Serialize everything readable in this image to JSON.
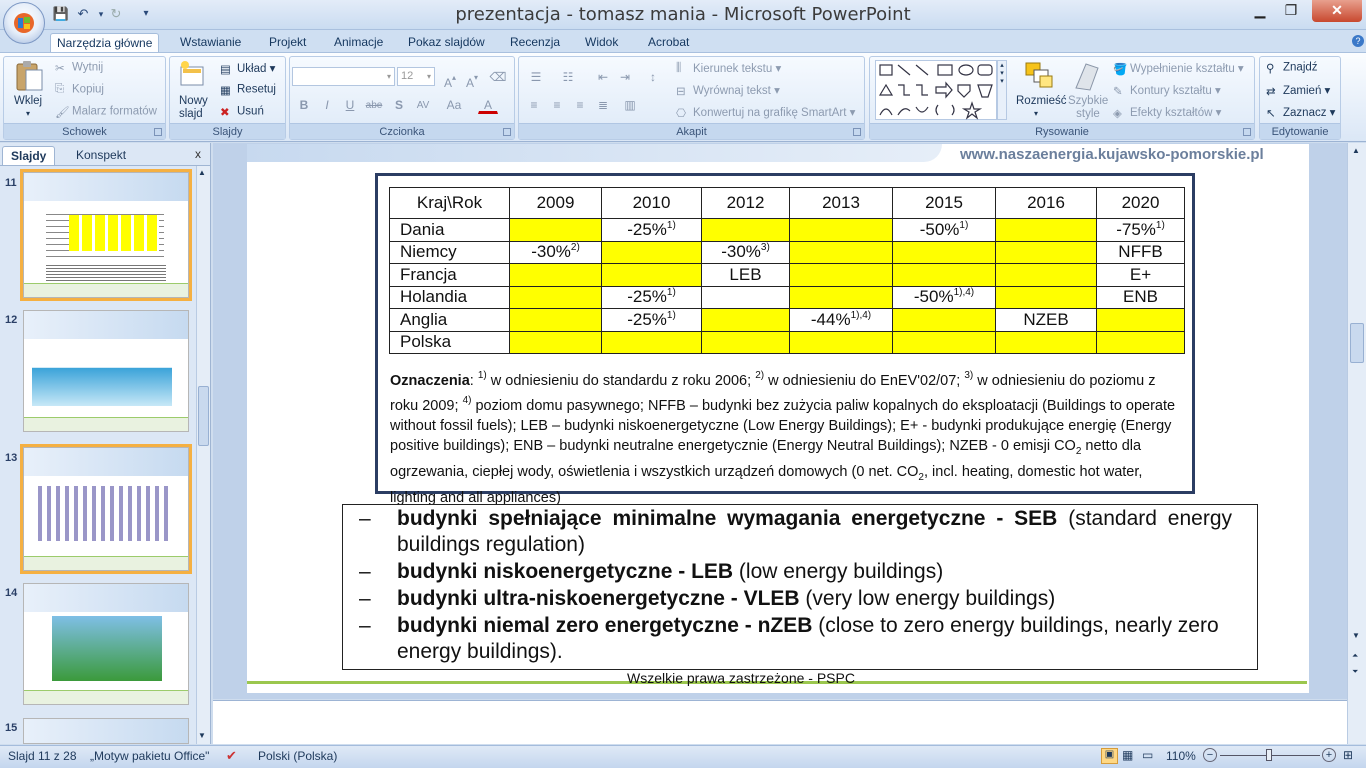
{
  "window": {
    "title": "prezentacja - tomasz mania - Microsoft PowerPoint"
  },
  "tabs": [
    "Narzędzia główne",
    "Wstawianie",
    "Projekt",
    "Animacje",
    "Pokaz slajdów",
    "Recenzja",
    "Widok",
    "Acrobat"
  ],
  "ribbon": {
    "clipboard": {
      "label": "Schowek",
      "paste": "Wklej",
      "cut": "Wytnij",
      "copy": "Kopiuj",
      "painter": "Malarz formatów"
    },
    "slides": {
      "label": "Slajdy",
      "new": "Nowy slajd",
      "layout": "Układ",
      "reset": "Resetuj",
      "delete": "Usuń"
    },
    "font": {
      "label": "Czcionka",
      "size": "12",
      "bold": "B",
      "italic": "I",
      "underline": "U",
      "strike": "abe",
      "shadow": "S",
      "spacing": "AV",
      "case": "Aa",
      "color": "A"
    },
    "paragraph": {
      "label": "Akapit",
      "direction": "Kierunek tekstu",
      "align": "Wyrównaj tekst",
      "smartart": "Konwertuj na grafikę SmartArt"
    },
    "drawing": {
      "label": "Rysowanie",
      "arrange": "Rozmieść",
      "quickstyles": "Szybkie style",
      "fill": "Wypełnienie kształtu",
      "outline": "Kontury kształtu",
      "effects": "Efekty kształtów"
    },
    "editing": {
      "label": "Edytowanie",
      "find": "Znajdź",
      "replace": "Zamień",
      "select": "Zaznacz"
    }
  },
  "pane": {
    "tab_slides": "Slajdy",
    "tab_outline": "Konspekt",
    "close": "x",
    "thumbs": [
      "11",
      "12",
      "13",
      "14",
      "15"
    ]
  },
  "slide": {
    "url": "www.naszaenergia.kujawsko-pomorskie.pl",
    "table": {
      "headers": [
        "Kraj\\Rok",
        "2009",
        "2010",
        "2012",
        "2013",
        "2015",
        "2016",
        "2020"
      ],
      "rows": [
        {
          "country": "Dania",
          "cells": [
            "",
            "-25%",
            "",
            "",
            "-50%",
            "",
            "-75%"
          ],
          "sups": [
            "",
            "1)",
            "",
            "",
            "1)",
            "",
            "1)"
          ],
          "yellow": [
            true,
            false,
            true,
            true,
            false,
            true,
            false
          ]
        },
        {
          "country": "Niemcy",
          "cells": [
            "-30%",
            "",
            "-30%",
            "",
            "",
            "",
            "NFFB"
          ],
          "sups": [
            "2)",
            "",
            "3)",
            "",
            "",
            "",
            ""
          ],
          "yellow": [
            false,
            true,
            false,
            true,
            true,
            true,
            false
          ]
        },
        {
          "country": "Francja",
          "cells": [
            "",
            "",
            "LEB",
            "",
            "",
            "",
            "E+"
          ],
          "sups": [
            "",
            "",
            "",
            "",
            "",
            "",
            ""
          ],
          "yellow": [
            true,
            true,
            false,
            true,
            true,
            true,
            false
          ]
        },
        {
          "country": "Holandia",
          "cells": [
            "",
            "-25%",
            "",
            "",
            "-50%",
            "",
            "ENB"
          ],
          "sups": [
            "",
            "1)",
            "",
            "",
            "1),4)",
            "",
            ""
          ],
          "yellow": [
            true,
            false,
            false,
            true,
            false,
            true,
            false
          ]
        },
        {
          "country": "Anglia",
          "cells": [
            "",
            "-25%",
            "",
            "-44%",
            "",
            "NZEB",
            ""
          ],
          "sups": [
            "",
            "1)",
            "",
            "1),4)",
            "",
            "",
            ""
          ],
          "yellow": [
            true,
            false,
            true,
            false,
            true,
            false,
            true
          ]
        },
        {
          "country": "Polska",
          "cells": [
            "",
            "",
            "",
            "",
            "",
            "",
            ""
          ],
          "sups": [
            "",
            "",
            "",
            "",
            "",
            "",
            ""
          ],
          "yellow": [
            true,
            true,
            true,
            true,
            true,
            true,
            true
          ]
        }
      ]
    },
    "legend": {
      "title": "Oznaczenia",
      "s1": "1)",
      "t1": " w odniesieniu do standardu z roku 2006; ",
      "s2": "2)",
      "t2": " w odniesieniu do EnEV'02/07; ",
      "s3": "3)",
      "t3": " w odniesieniu do poziomu z roku 2009; ",
      "s4": "4)",
      "t4": " poziom domu pasywnego; NFFB – budynki bez zużycia paliw kopalnych do eksploatacji (Buildings to operate without fossil fuels); LEB – budynki niskoenergetyczne (Low Energy Buildings); E+ - budynki produkujące energię (Energy positive buildings); ENB – budynki neutralne energetycznie (Energy Neutral Buildings); NZEB - 0 emisji CO",
      "co2a": "2",
      "t5": " netto dla ogrzewania, ciepłej wody, oświetlenia i wszystkich urządzeń domowych (0 net. CO",
      "co2b": "2",
      "t6": ", incl. heating, domestic hot water, lighting and all appliances)"
    },
    "bullets": [
      {
        "dash": "–",
        "bold": "budynki spełniające minimalne wymagania energetyczne - SEB",
        "rest": " (standard energy buildings regulation)"
      },
      {
        "dash": "–",
        "bold": "budynki niskoenergetyczne - LEB",
        "rest": " (low energy buildings)"
      },
      {
        "dash": "–",
        "bold": "budynki ultra-niskoenergetyczne - VLEB",
        "rest": " (very low energy buildings)"
      },
      {
        "dash": "–",
        "bold": "budynki niemal zero energetyczne - nZEB",
        "rest": " (close to zero energy buildings, nearly zero energy buildings)."
      }
    ],
    "footer": "Wszelkie prawa zastrzeżone - PSPC"
  },
  "status": {
    "slide": "Slajd 11 z 28",
    "theme": "„Motyw pakietu Office\"",
    "language": "Polski (Polska)",
    "zoom": "110%"
  }
}
